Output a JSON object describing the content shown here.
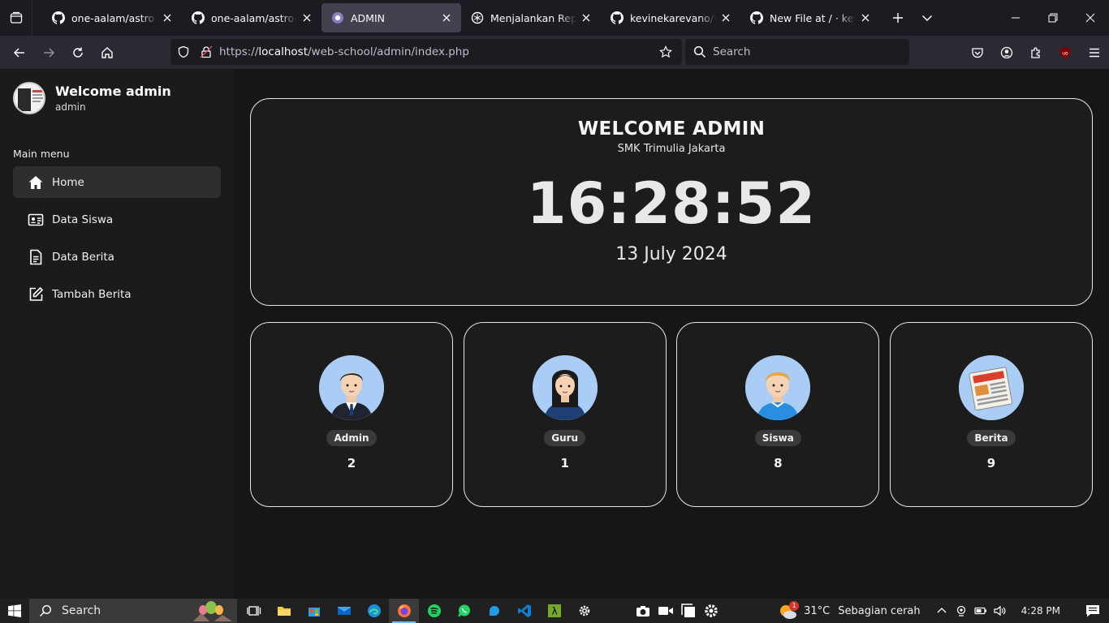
{
  "browser": {
    "tabs": [
      {
        "title": "one-aalam/astro-meteor",
        "icon": "github-icon",
        "active": false
      },
      {
        "title": "one-aalam/astro-meteor",
        "icon": "github-icon",
        "active": false
      },
      {
        "title": "ADMIN",
        "icon": "php-icon",
        "active": true
      },
      {
        "title": "Menjalankan Repo Lokal",
        "icon": "openai-icon",
        "active": false
      },
      {
        "title": "kevinekarevano/web-school",
        "icon": "github-icon",
        "active": false
      },
      {
        "title": "New File at / · kevinekarevano",
        "icon": "github-icon",
        "active": false
      }
    ],
    "url_prefix": "https://",
    "url_host": "localhost",
    "url_path": "/web-school/admin/index.php",
    "search_placeholder": "Search"
  },
  "sidebar": {
    "welcome": "Welcome admin",
    "role": "admin",
    "menu_title": "Main menu",
    "items": [
      {
        "label": "Home",
        "icon": "home-icon",
        "active": true
      },
      {
        "label": "Data Siswa",
        "icon": "id-card-icon",
        "active": false
      },
      {
        "label": "Data Berita",
        "icon": "document-icon",
        "active": false
      },
      {
        "label": "Tambah Berita",
        "icon": "edit-icon",
        "active": false
      }
    ]
  },
  "hero": {
    "title": "WELCOME ADMIN",
    "subtitle": "SMK Trimulia Jakarta",
    "time": "16:28:52",
    "date": "13 July 2024"
  },
  "stats": [
    {
      "label": "Admin",
      "count": "2",
      "icon": "admin-avatar-icon"
    },
    {
      "label": "Guru",
      "count": "1",
      "icon": "teacher-avatar-icon"
    },
    {
      "label": "Siswa",
      "count": "8",
      "icon": "student-avatar-icon"
    },
    {
      "label": "Berita",
      "count": "9",
      "icon": "newspaper-icon"
    }
  ],
  "taskbar": {
    "search_label": "Search",
    "weather_temp": "31°C",
    "weather_desc": "Sebagian cerah",
    "time": "4:28 PM",
    "weather_badge": "1"
  },
  "colors": {
    "background": "#161616",
    "sidebar": "#1b1b1b",
    "card_border": "#e6e6e6",
    "avatar_bg": "#a9cdf5"
  }
}
